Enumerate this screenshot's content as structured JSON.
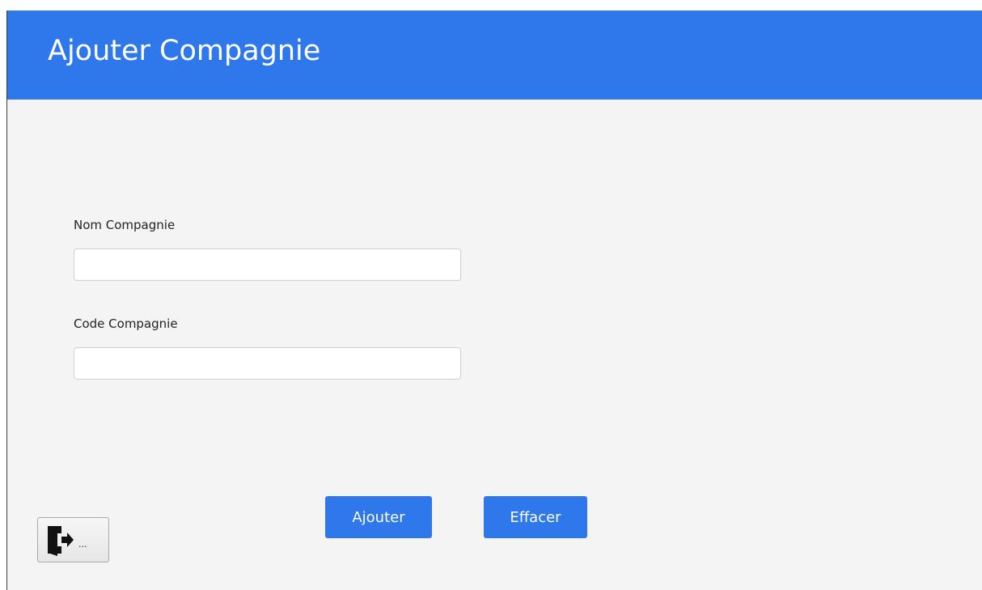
{
  "window": {
    "title": "Ajouter Compagnie"
  },
  "form": {
    "nom_label": "Nom Compagnie",
    "nom_value": "",
    "code_label": "Code Compagnie",
    "code_value": ""
  },
  "actions": {
    "add_label": "Ajouter",
    "clear_label": "Effacer",
    "exit_ellipsis": "..."
  },
  "icons": {
    "exit": "exit-door-icon"
  },
  "colors": {
    "accent": "#2f78ec",
    "background": "#f4f4f4"
  }
}
